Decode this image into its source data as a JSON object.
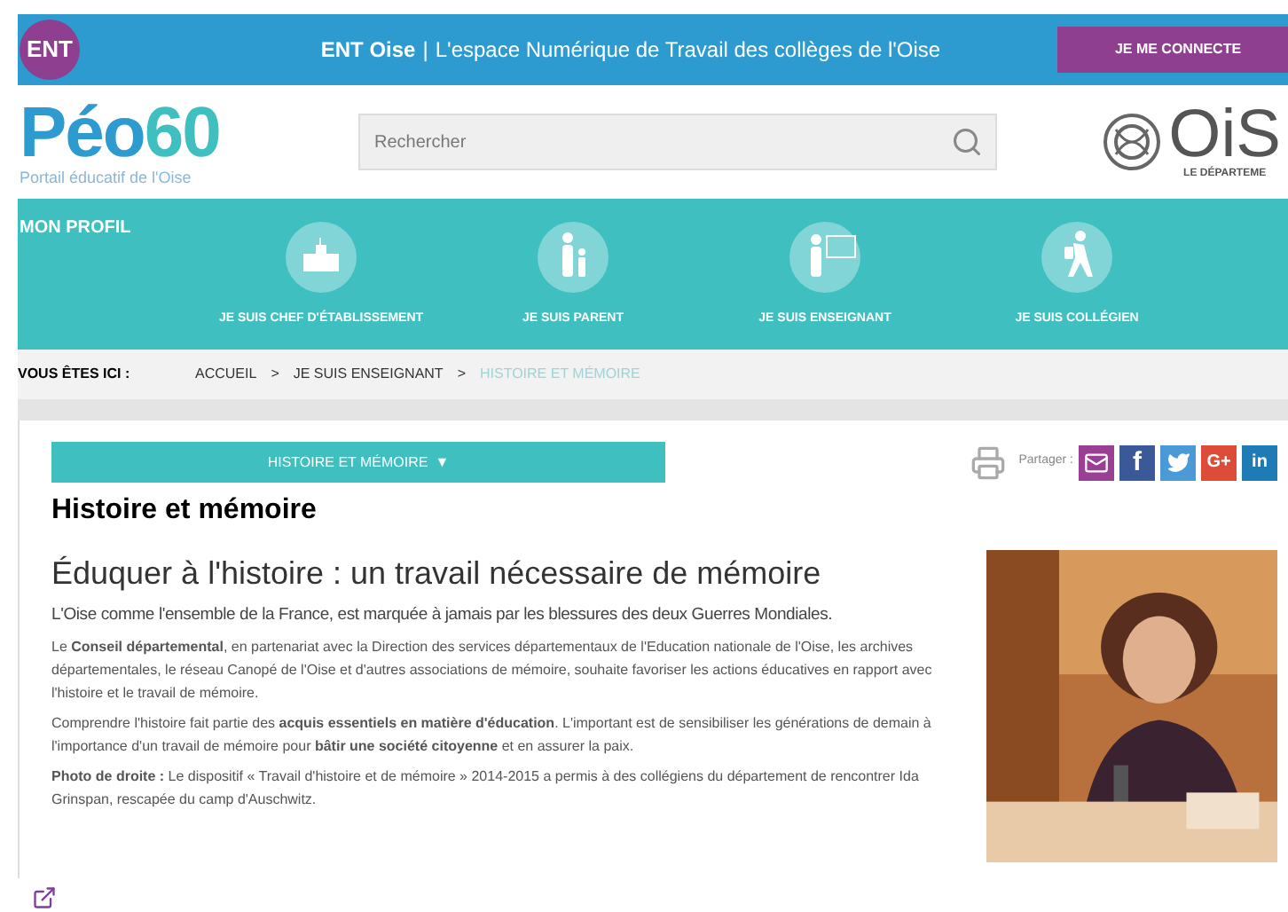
{
  "top_bar": {
    "logo": "ENT",
    "site_name": "ENT Oise",
    "separator": "|",
    "tagline": "L'espace Numérique de Travail des collèges de l'Oise",
    "login_button": "JE ME CONNECTE"
  },
  "header": {
    "logo_first": "Péo",
    "logo_second": "60",
    "logo_subtitle": "Portail éducatif de l'Oise",
    "search": {
      "placeholder": "Rechercher"
    },
    "partner_logo": "OiS",
    "partner_subtitle": "LE DÉPARTEME"
  },
  "profile_bar": {
    "label": "MON PROFIL",
    "items": [
      {
        "kind": "building",
        "label": "JE SUIS CHEF D'ÉTABLISSEMENT"
      },
      {
        "kind": "parent",
        "label": "JE SUIS PARENT"
      },
      {
        "kind": "teacher",
        "label": "JE SUIS ENSEIGNANT"
      },
      {
        "kind": "student",
        "label": "JE SUIS COLLÉGIEN"
      }
    ]
  },
  "breadcrumb": {
    "label": "VOUS ÊTES ICI :",
    "items": [
      {
        "kind": "link",
        "text": "ACCUEIL",
        "current": false
      },
      {
        "kind": "separator",
        "text": ">"
      },
      {
        "kind": "link",
        "text": "JE SUIS ENSEIGNANT",
        "current": false
      },
      {
        "kind": "separator",
        "text": ">"
      },
      {
        "kind": "link",
        "text": "HISTOIRE ET MÉMOIRE",
        "current": true
      }
    ]
  },
  "section_menu": {
    "label": "HISTOIRE ET MÉMOIRE",
    "caret": "▼"
  },
  "share": {
    "label": "Partager :",
    "buttons": [
      {
        "kind": "mail",
        "color": "#9b3f94"
      },
      {
        "kind": "text",
        "text": "f",
        "color": "#3b5998"
      },
      {
        "kind": "bird",
        "color": "#4a9ad8"
      },
      {
        "kind": "text",
        "text": "G+",
        "color": "#dd4b39"
      },
      {
        "kind": "text",
        "text": "in",
        "color": "#1f7bb6"
      }
    ]
  },
  "article": {
    "page_title": "Histoire et mémoire",
    "heading": "Éduquer à l'histoire : un travail nécessaire de mémoire",
    "lead": "L'Oise comme l'ensemble de la France, est marquée à jamais par les blessures des deux Guerres Mondiales.",
    "paragraphs": [
      "Le **Conseil départemental**, en partenariat avec la Direction des services départementaux de l'Education nationale de l'Oise, les archives départementales, le réseau Canopé de l'Oise et d'autres associations de mémoire, souhaite favoriser les actions éducatives en rapport avec l'histoire et le travail de mémoire.",
      "Comprendre l'histoire fait partie des **acquis essentiels en matière d'éducation**. L'important est de sensibiliser les générations de demain à l'importance d'un travail de mémoire pour **bâtir une société citoyenne** et en assurer la paix.",
      "**Photo de droite :** Le dispositif « Travail d'histoire et de mémoire » 2014-2015 a permis à des collégiens du département de rencontrer Ida Grinspan, rescapée du camp d'Auschwitz."
    ],
    "photo": {
      "kind": "picture"
    }
  }
}
